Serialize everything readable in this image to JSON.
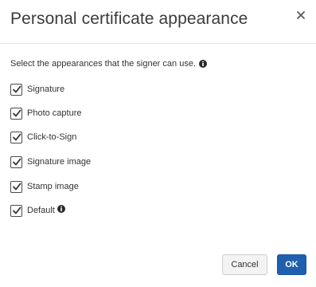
{
  "dialog": {
    "title": "Personal certificate appearance",
    "close_icon": "close-icon"
  },
  "instruction": {
    "text": "Select the appearances that the signer can use.",
    "icon": "info-icon"
  },
  "options": [
    {
      "label": "Signature",
      "checked": true
    },
    {
      "label": "Photo capture",
      "checked": true
    },
    {
      "label": "Click-to-Sign",
      "checked": true
    },
    {
      "label": "Signature image",
      "checked": true
    },
    {
      "label": "Stamp image",
      "checked": true
    },
    {
      "label": "Default",
      "checked": true,
      "icon": "info-icon"
    }
  ],
  "buttons": {
    "cancel_label": "Cancel",
    "ok_label": "OK"
  },
  "colors": {
    "primary": "#1f5fae",
    "secondary_bg": "#f3f3f3"
  }
}
